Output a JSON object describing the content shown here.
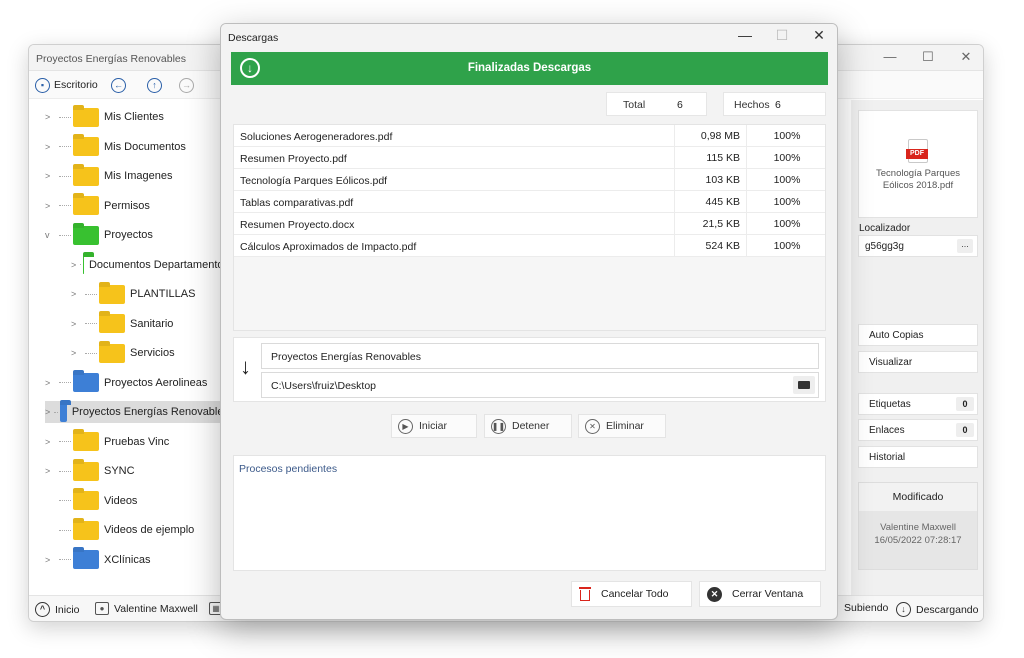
{
  "main_window": {
    "title": "Proyectos Energías Renovables",
    "toolbar": {
      "location_label": "Escritorio"
    },
    "tree": [
      {
        "label": "Mis Clientes",
        "color": "yellow",
        "expand": ">"
      },
      {
        "label": "Mis Documentos",
        "color": "yellow",
        "expand": ">"
      },
      {
        "label": "Mis Imagenes",
        "color": "yellow",
        "expand": ">"
      },
      {
        "label": "Permisos",
        "color": "yellow",
        "expand": ">"
      },
      {
        "label": "Proyectos",
        "color": "green",
        "expand": "v"
      },
      {
        "label": "Documentos Departamentos",
        "color": "green",
        "expand": ">"
      },
      {
        "label": "PLANTILLAS",
        "color": "yellow",
        "expand": ">"
      },
      {
        "label": "Sanitario",
        "color": "yellow",
        "expand": ">"
      },
      {
        "label": "Servicios",
        "color": "yellow",
        "expand": ">"
      },
      {
        "label": "Proyectos Aerolineas",
        "color": "blue",
        "expand": ">"
      },
      {
        "label": "Proyectos Energías Renovables",
        "color": "blue",
        "expand": ">"
      },
      {
        "label": "Pruebas Vinc",
        "color": "yellow",
        "expand": ">"
      },
      {
        "label": "SYNC",
        "color": "yellow",
        "expand": ">"
      },
      {
        "label": "Videos",
        "color": "yellow",
        "expand": ""
      },
      {
        "label": "Videos de ejemplo",
        "color": "yellow",
        "expand": ""
      },
      {
        "label": "XClínicas",
        "color": "blue",
        "expand": ">"
      }
    ],
    "statusbar": {
      "home_label": "Inicio",
      "user_label": "Valentine Maxwell",
      "uploading_label": "Subiendo",
      "downloading_label": "Descargando"
    },
    "right_panel": {
      "preview_badge": "PDF",
      "preview_caption_1": "Tecnología Parques",
      "preview_caption_2": "Eólicos 2018.pdf",
      "locator_label": "Localizador",
      "locator_value": "g56gg3g",
      "locator_more": "...",
      "auto_copies": "Auto Copias",
      "view": "Visualizar",
      "tags": "Etiquetas",
      "tags_count": "0",
      "links": "Enlaces",
      "links_count": "0",
      "history": "Historial",
      "modified_label": "Modificado",
      "modified_by": "Valentine Maxwell",
      "modified_date": "16/05/2022 07:28:17"
    }
  },
  "dialog": {
    "title": "Descargas",
    "banner_text": "Finalizadas Descargas",
    "total_label": "Total",
    "total_value": "6",
    "done_label": "Hechos",
    "done_value": "6",
    "downloads": [
      {
        "name": "Soluciones Aerogeneradores.pdf",
        "size": "0,98 MB",
        "progress": "100%"
      },
      {
        "name": "Resumen Proyecto.pdf",
        "size": "115 KB",
        "progress": "100%"
      },
      {
        "name": "Tecnología Parques Eólicos.pdf",
        "size": "103 KB",
        "progress": "100%"
      },
      {
        "name": "Tablas comparativas.pdf",
        "size": "445 KB",
        "progress": "100%"
      },
      {
        "name": "Resumen Proyecto.docx",
        "size": "21,5 KB",
        "progress": "100%"
      },
      {
        "name": "Cálculos Aproximados de Impacto.pdf",
        "size": "524 KB",
        "progress": "100%"
      }
    ],
    "destination_project": "Proyectos Energías Renovables",
    "destination_path": "C:\\Users\\fruiz\\Desktop",
    "start_label": "Iniciar",
    "stop_label": "Detener",
    "delete_label": "Eliminar",
    "pending_label": "Procesos pendientes",
    "cancel_all_label": "Cancelar Todo",
    "close_window_label": "Cerrar Ventana"
  }
}
